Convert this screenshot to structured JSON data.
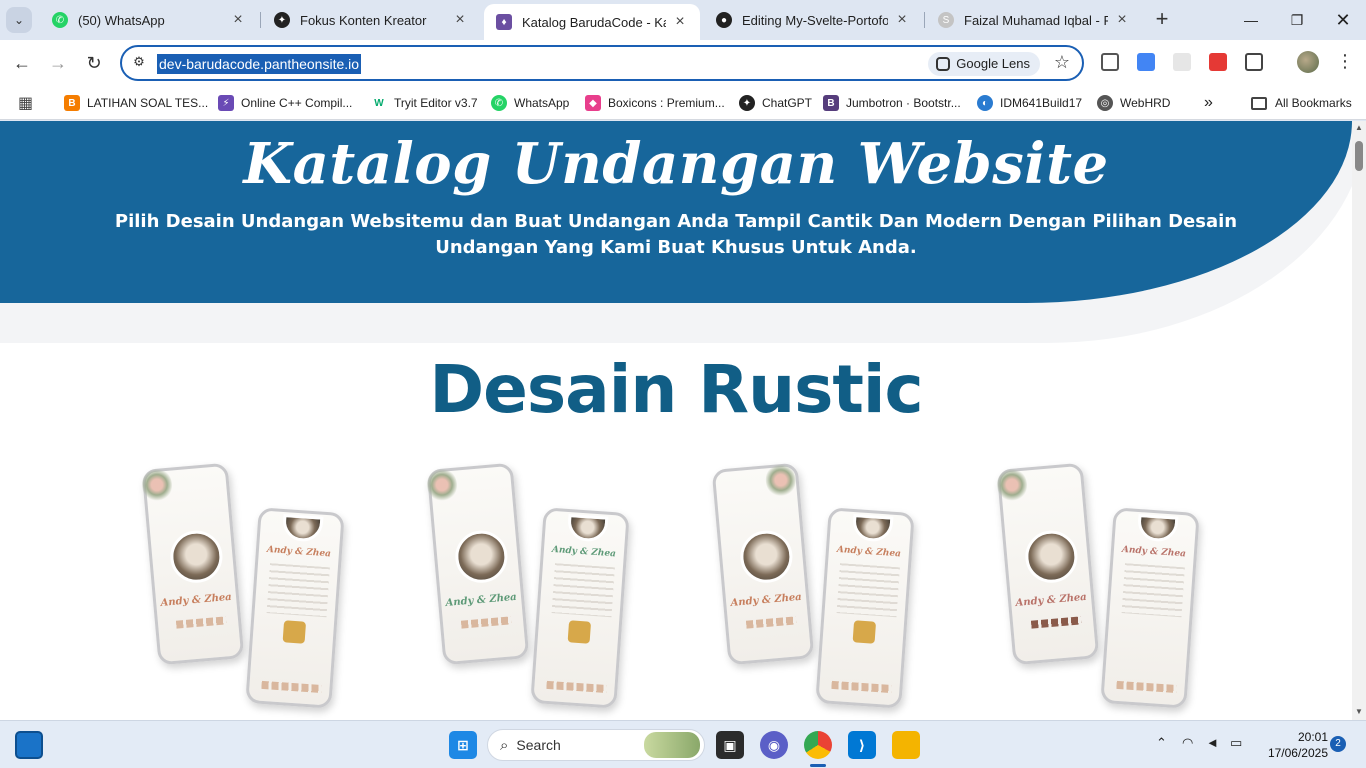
{
  "tabs": [
    {
      "label": "(50) WhatsApp",
      "icon": "whatsapp-icon",
      "color": "#25d366"
    },
    {
      "label": "Fokus Konten Kreator",
      "icon": "openai-icon",
      "color": "#222222"
    },
    {
      "label": "Katalog BarudaCode - Katalo",
      "icon": "barudacode-icon",
      "color": "#6b4fa1"
    },
    {
      "label": "Editing My-Svelte-Portofolio",
      "icon": "github-icon",
      "color": "#222222"
    },
    {
      "label": "Faizal Muhamad Iqbal - Portf",
      "icon": "svelte-icon",
      "color": "#bbbbbb"
    }
  ],
  "address": {
    "url": "dev-barudacode.pantheonsite.io",
    "lens_label": "Google Lens"
  },
  "bookmarks": [
    {
      "label": "LATIHAN SOAL TES...",
      "icon": "blogger-icon",
      "color": "#f57d00",
      "glyph": "B"
    },
    {
      "label": "Online C++ Compil...",
      "icon": "bolt-icon",
      "color": "#6a4ab5",
      "glyph": "⚡"
    },
    {
      "label": "Tryit Editor v3.7",
      "icon": "w3schools-icon",
      "color": "#04aa6d",
      "glyph": "W"
    },
    {
      "label": "WhatsApp",
      "icon": "whatsapp-icon",
      "color": "#25d366",
      "glyph": "✆"
    },
    {
      "label": "Boxicons : Premium...",
      "icon": "boxicons-icon",
      "color": "#e83e8c",
      "glyph": "◆"
    },
    {
      "label": "ChatGPT",
      "icon": "openai-icon",
      "color": "#222222",
      "glyph": "✦"
    },
    {
      "label": "Jumbotron · Bootstr...",
      "icon": "bootstrap-icon",
      "color": "#563d7c",
      "glyph": "B"
    },
    {
      "label": "IDM641Build17",
      "icon": "idm-icon",
      "color": "#2a7bd0",
      "glyph": "◐"
    },
    {
      "label": "WebHRD",
      "icon": "globe-icon",
      "color": "#555555",
      "glyph": "◎"
    }
  ],
  "all_bookmarks_label": "All Bookmarks",
  "hero": {
    "title": "Katalog Undangan Website",
    "subtitle": "Pilih Desain Undangan Websitemu dan Buat Undangan Anda Tampil Cantik Dan Modern Dengan Pilihan Desain Undangan Yang Kami Buat Khusus Untuk Anda."
  },
  "section": {
    "title": "Desain Rustic"
  },
  "mockups": [
    {
      "names": "Andy & Zhea",
      "accent": "#c77f5e"
    },
    {
      "names": "Andy & Zhea",
      "accent": "#5e9a78"
    },
    {
      "names": "Andy & Zhea",
      "accent": "#c77f5e"
    },
    {
      "names": "Andy & Zhea",
      "accent": "#b9736a"
    }
  ],
  "taskbar": {
    "search_label": "Search",
    "time": "20:01",
    "date": "17/06/2025",
    "notifications": "2"
  },
  "colors": {
    "hero": "#17669b",
    "section_title": "#115e86",
    "accent": "#1a5fb4"
  }
}
